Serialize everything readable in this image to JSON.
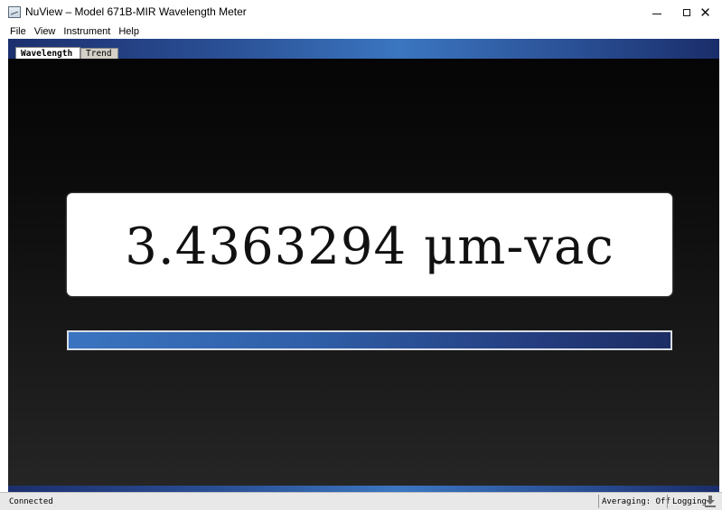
{
  "window": {
    "title": "NuView – Model 671B-MIR Wavelength Meter",
    "icon": "app-icon",
    "controls": {
      "minimize": "minimize-icon",
      "maximize": "maximize-icon",
      "close": "close-icon"
    }
  },
  "menu": {
    "items": [
      "File",
      "View",
      "Instrument",
      "Help"
    ]
  },
  "tabs": [
    {
      "label": "Wavelength",
      "active": true
    },
    {
      "label": "Trend",
      "active": false
    }
  ],
  "reading": {
    "value": "3.4363294 μm-vac"
  },
  "signal": {
    "level_fraction": 1.0
  },
  "status": {
    "connection": "Connected",
    "averaging": "Averaging: Off",
    "logging": "Logging",
    "logging_icon": "download-arrow-icon"
  },
  "colors": {
    "band_dark": "#1c2f6e",
    "band_light": "#3b76c0",
    "panel_top": "#050505",
    "panel_bottom": "#252525",
    "readout_bg": "#ffffff"
  }
}
